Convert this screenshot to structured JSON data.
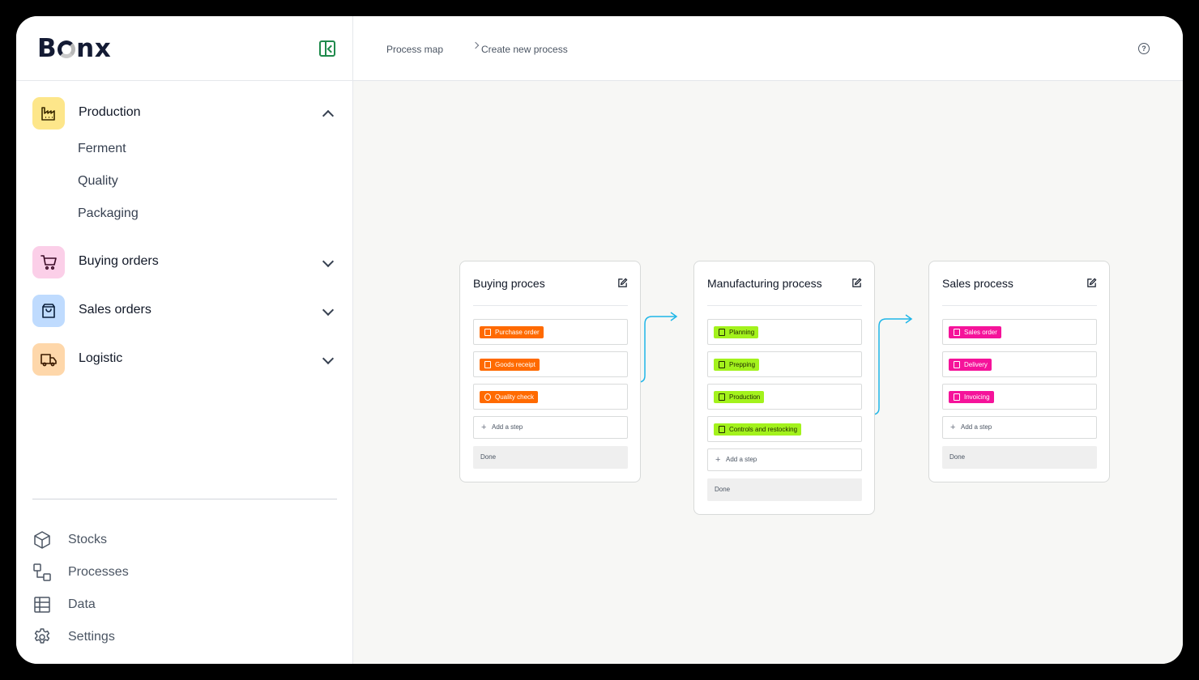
{
  "brand": {
    "logo": "Bonx",
    "logo_prefix": "B",
    "logo_suffix": "nx"
  },
  "breadcrumb": {
    "items": [
      "Process map",
      "Create new process"
    ]
  },
  "sidebar": {
    "groups": [
      {
        "label": "Production",
        "icon": "factory-icon",
        "color": "#fde68a",
        "expanded": true,
        "children": [
          "Ferment",
          "Quality",
          "Packaging"
        ]
      },
      {
        "label": "Buying orders",
        "icon": "cart-icon",
        "color": "#fbcfe8",
        "expanded": false
      },
      {
        "label": "Sales orders",
        "icon": "shopping-bag-icon",
        "color": "#bfdbfe",
        "expanded": false
      },
      {
        "label": "Logistic",
        "icon": "truck-icon",
        "color": "#fed7aa",
        "expanded": false
      }
    ],
    "bottom": [
      {
        "label": "Stocks",
        "icon": "box-icon"
      },
      {
        "label": "Processes",
        "icon": "flow-icon"
      },
      {
        "label": "Data",
        "icon": "table-icon"
      },
      {
        "label": "Settings",
        "icon": "gear-icon"
      }
    ]
  },
  "processes": [
    {
      "title": "Buying proces",
      "tag_color": "#ff6a00",
      "steps": [
        "Purchase order",
        "Goods receipt",
        "Quality check"
      ],
      "add_step": "Add a step",
      "done": "Done"
    },
    {
      "title": "Manufacturing process",
      "tag_color": "#a3f21c",
      "steps": [
        "Planning",
        "Prepping",
        "Production",
        "Controls and restocking"
      ],
      "add_step": "Add a step",
      "done": "Done"
    },
    {
      "title": "Sales process",
      "tag_color": "#f5139a",
      "steps": [
        "Sales order",
        "Delivery",
        "Invoicing"
      ],
      "add_step": "Add a step",
      "done": "Done"
    }
  ],
  "colors": {
    "connector": "#1fb6e8",
    "canvas": "#f7f7f5",
    "accent": "#1f8a4c"
  }
}
